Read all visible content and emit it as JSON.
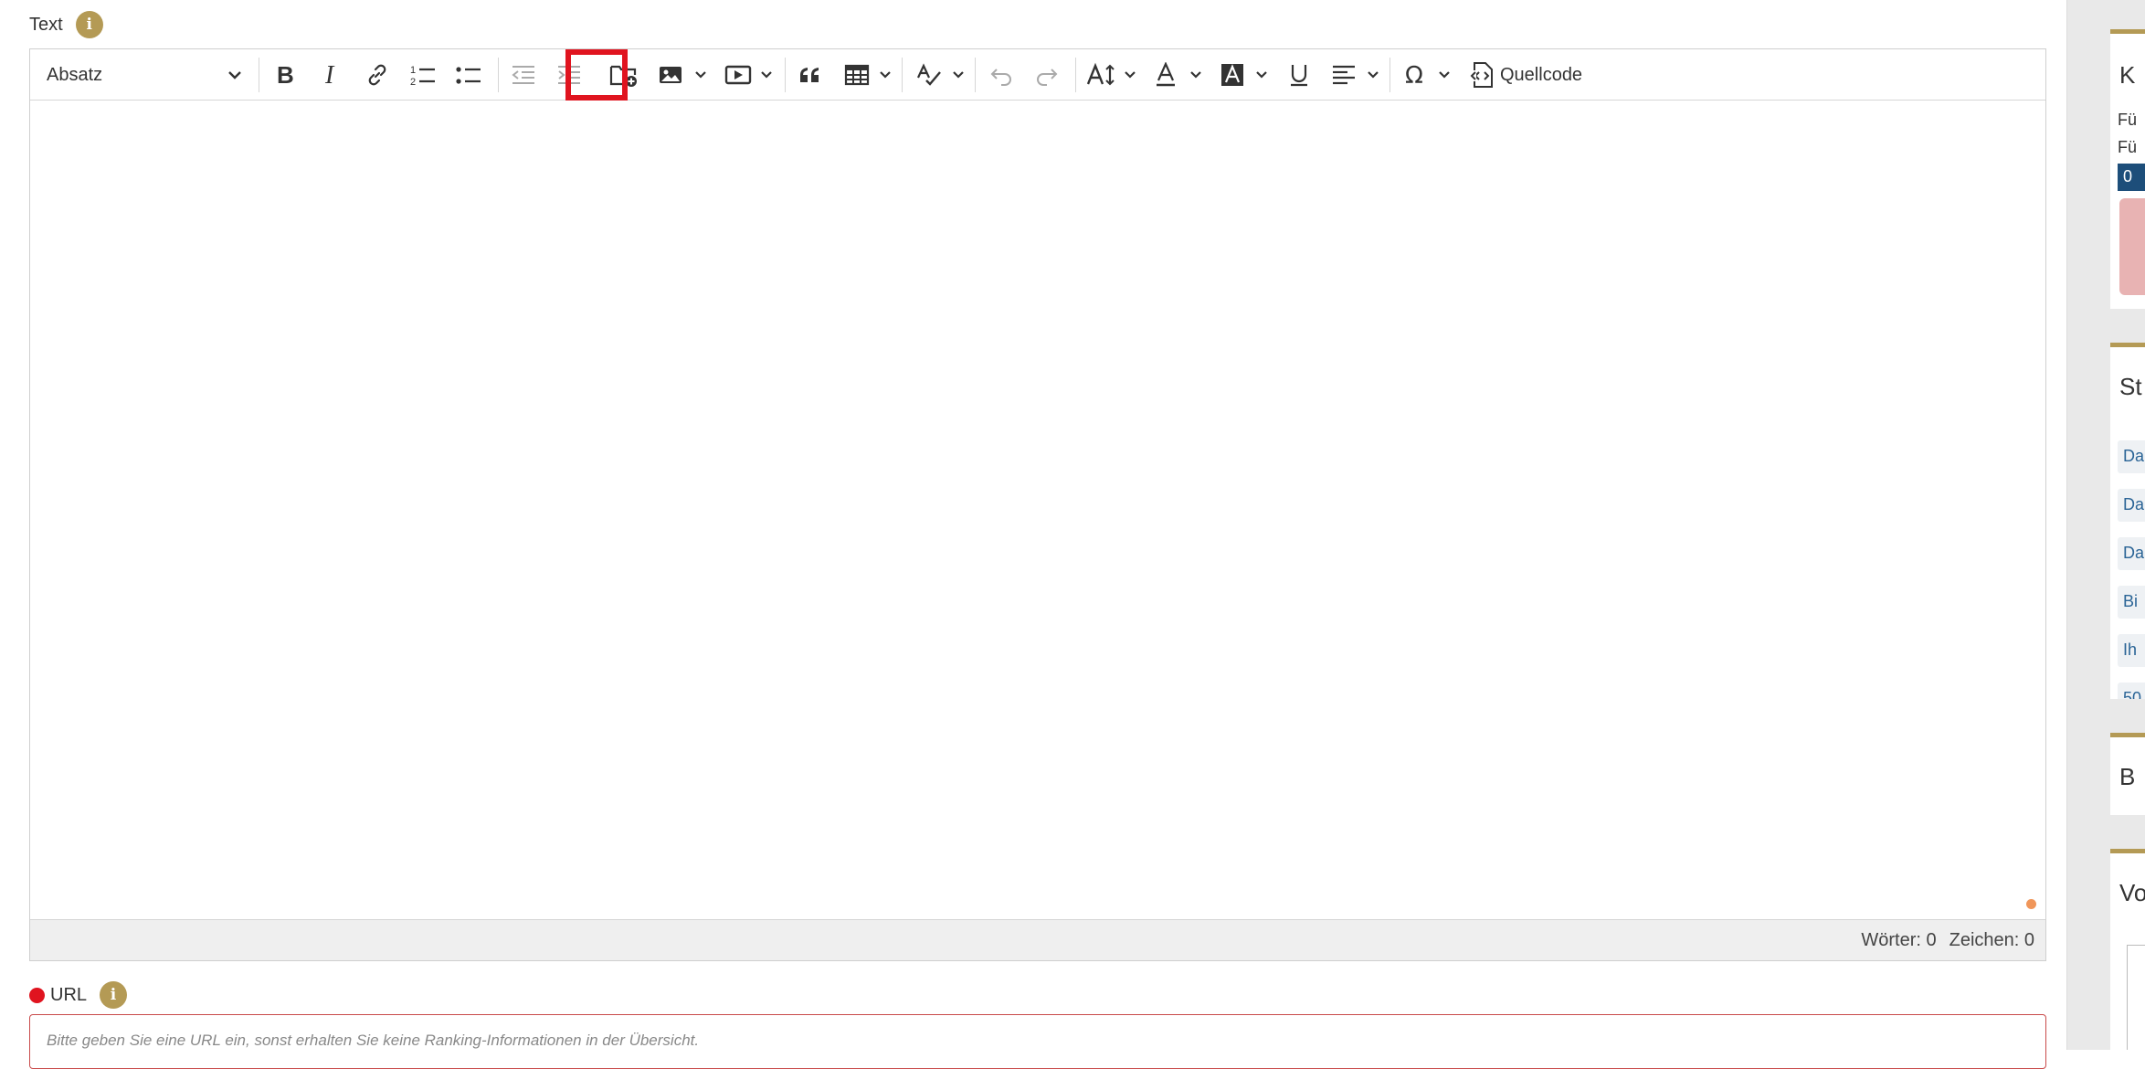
{
  "text_field": {
    "label": "Text",
    "info_icon": "i"
  },
  "toolbar": {
    "paragraph_select": "Absatz",
    "buttons": [
      {
        "name": "bold-icon"
      },
      {
        "name": "italic-icon"
      },
      {
        "name": "link-icon"
      },
      {
        "name": "numbered-list-icon"
      },
      {
        "name": "bulleted-list-icon"
      },
      {
        "name": "outdent-icon"
      },
      {
        "name": "indent-icon"
      },
      {
        "name": "folder-add-icon",
        "highlighted": true
      },
      {
        "name": "image-icon"
      },
      {
        "name": "media-icon"
      },
      {
        "name": "blockquote-icon"
      },
      {
        "name": "table-icon"
      },
      {
        "name": "spellcheck-icon"
      },
      {
        "name": "undo-icon"
      },
      {
        "name": "redo-icon"
      },
      {
        "name": "font-size-icon"
      },
      {
        "name": "font-color-icon"
      },
      {
        "name": "background-color-icon"
      },
      {
        "name": "underline-icon"
      },
      {
        "name": "align-icon"
      },
      {
        "name": "special-chars-icon"
      },
      {
        "name": "source-code-icon"
      }
    ],
    "source_label": "Quellcode",
    "highlight_color": "#e0141f"
  },
  "statusbar": {
    "words": "Wörter: 0",
    "chars": "Zeichen: 0"
  },
  "url_field": {
    "label": "URL",
    "info_icon": "i",
    "placeholder": "Bitte geben Sie eine URL ein, sonst erhalten Sie keine Ranking-Informationen in der Übersicht.",
    "required_color": "#e0141f"
  },
  "sidebar": {
    "card1": {
      "title": "K",
      "line1": "Fü",
      "line2": "Fü",
      "box": "0"
    },
    "card2": {
      "title": "St",
      "chips": [
        "Da",
        "Da",
        "Da",
        "Bi",
        "Ih",
        "50"
      ]
    },
    "card3": {
      "title": "B"
    },
    "card4": {
      "title": "Vo"
    }
  },
  "colors": {
    "accent_gold": "#b49a55",
    "link_blue": "#2a6496",
    "dark_blue": "#1d4e7a"
  }
}
